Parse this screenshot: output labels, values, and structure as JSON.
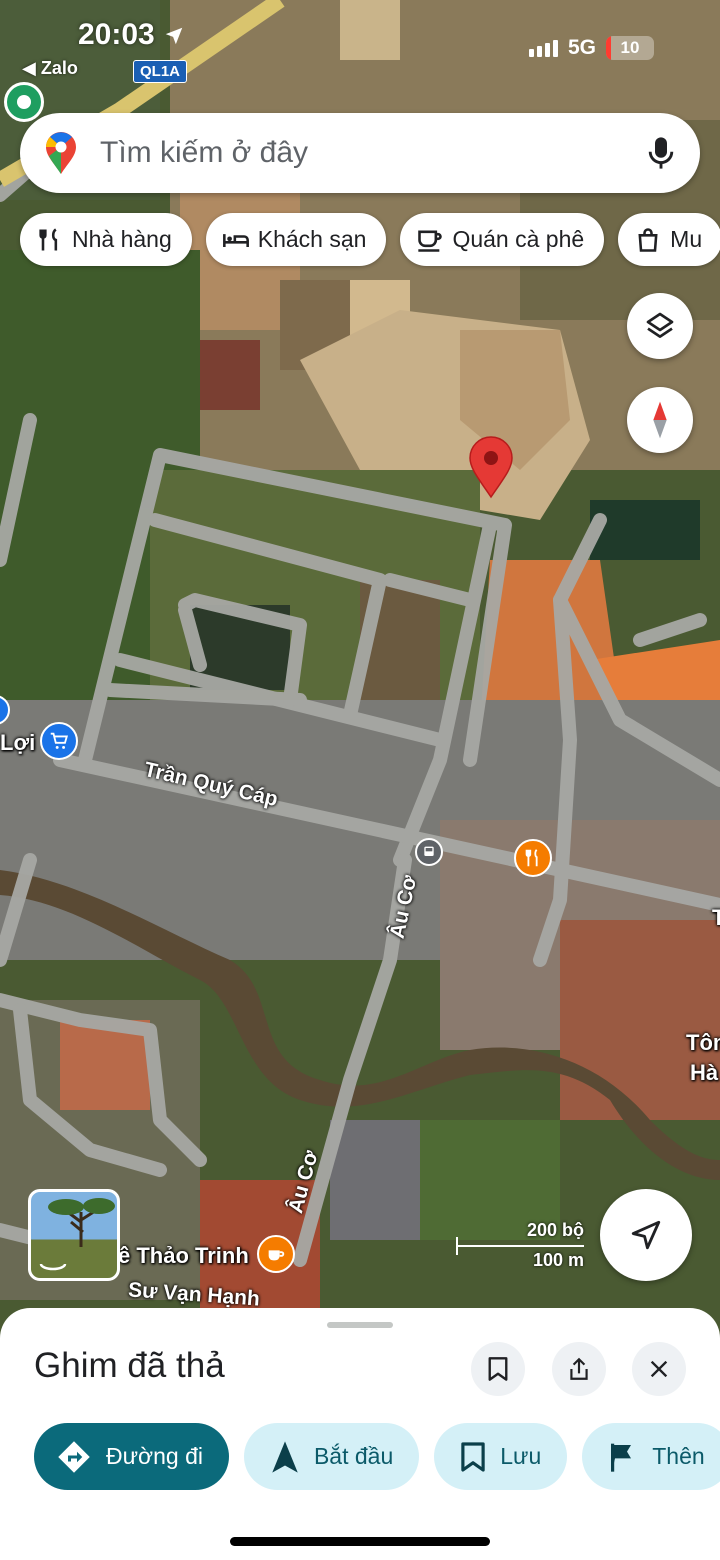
{
  "status_bar": {
    "time": "20:03",
    "back_app": "◀ Zalo",
    "road_shield": "QL1A",
    "network": "5G",
    "battery": "10",
    "battery_level_pct": 10
  },
  "search": {
    "placeholder": "Tìm kiếm ở đây"
  },
  "chips": [
    {
      "label": "Nhà hàng",
      "icon": "fork-knife-icon"
    },
    {
      "label": "Khách sạn",
      "icon": "bed-icon"
    },
    {
      "label": "Quán cà phê",
      "icon": "coffee-cup-icon"
    },
    {
      "label": "Mu",
      "icon": "shopping-bag-icon"
    }
  ],
  "map": {
    "labels": {
      "loi": "Lợi",
      "tran_quy_cap": "Trần Quý Cáp",
      "au_co_1": "Âu Cơ",
      "au_co_2": "Âu Cơ",
      "thao_trinh": "ê Thảo Trinh",
      "su_van_hanh": "Sư Vạn Hạnh",
      "tom": "Tôm",
      "ha": "Hà",
      "edge_t": "T"
    },
    "scale": {
      "upper": "200 bộ",
      "lower": "100 m"
    },
    "colors": {
      "pin": "#e53935",
      "shopping": "#1a73e8",
      "food": "#f57c00",
      "coffee": "#f57c00",
      "transit": "#5f6368"
    }
  },
  "sheet": {
    "title": "Ghim đã thả",
    "actions": [
      {
        "label": "Đường đi",
        "icon": "directions-icon",
        "style": "primary"
      },
      {
        "label": "Bắt đầu",
        "icon": "navigation-arrow-icon",
        "style": "secondary"
      },
      {
        "label": "Lưu",
        "icon": "bookmark-icon",
        "style": "secondary"
      },
      {
        "label": "Thên",
        "icon": "flag-icon",
        "style": "secondary"
      }
    ]
  }
}
